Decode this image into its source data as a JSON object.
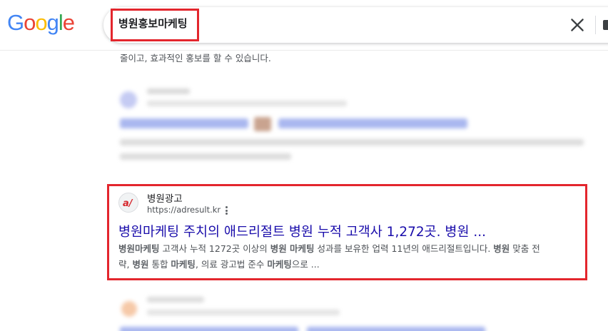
{
  "logo": {
    "letters": [
      "G",
      "o",
      "o",
      "g",
      "l",
      "e"
    ],
    "colors": [
      "#4285f4",
      "#ea4335",
      "#fbbc05",
      "#4285f4",
      "#34a853",
      "#ea4335"
    ]
  },
  "search": {
    "query": "병원홍보마케팅"
  },
  "snippet_top": "줄이고, 효과적인 홍보를 할 수 있습니다.",
  "result": {
    "site_name": "병원광고",
    "url": "https://adresult.kr",
    "title": "병원마케팅 주치의 애드리절트 병원 누적 고객사 1,272곳. 병원 ...",
    "desc_line1": [
      {
        "t": "병원마케팅",
        "b": true
      },
      {
        "t": " 고객사 누적 1272곳 이상의 ",
        "b": false
      },
      {
        "t": "병원 마케팅",
        "b": true
      },
      {
        "t": " 성과를 보유한 업력 11년의 애드리절트입니다. ",
        "b": false
      },
      {
        "t": "병원",
        "b": true
      },
      {
        "t": " 맞춤 전",
        "b": false
      }
    ],
    "desc_line2": [
      {
        "t": "략, ",
        "b": false
      },
      {
        "t": "병원",
        "b": true
      },
      {
        "t": " 통합 ",
        "b": false
      },
      {
        "t": "마케팅",
        "b": true
      },
      {
        "t": ", 의료 광고법 준수 ",
        "b": false
      },
      {
        "t": "마케팅",
        "b": true
      },
      {
        "t": "으로 ...",
        "b": false
      }
    ]
  },
  "colors": {
    "highlight": "#e3262d",
    "link": "#1a0dab",
    "text": "#4d5156"
  }
}
